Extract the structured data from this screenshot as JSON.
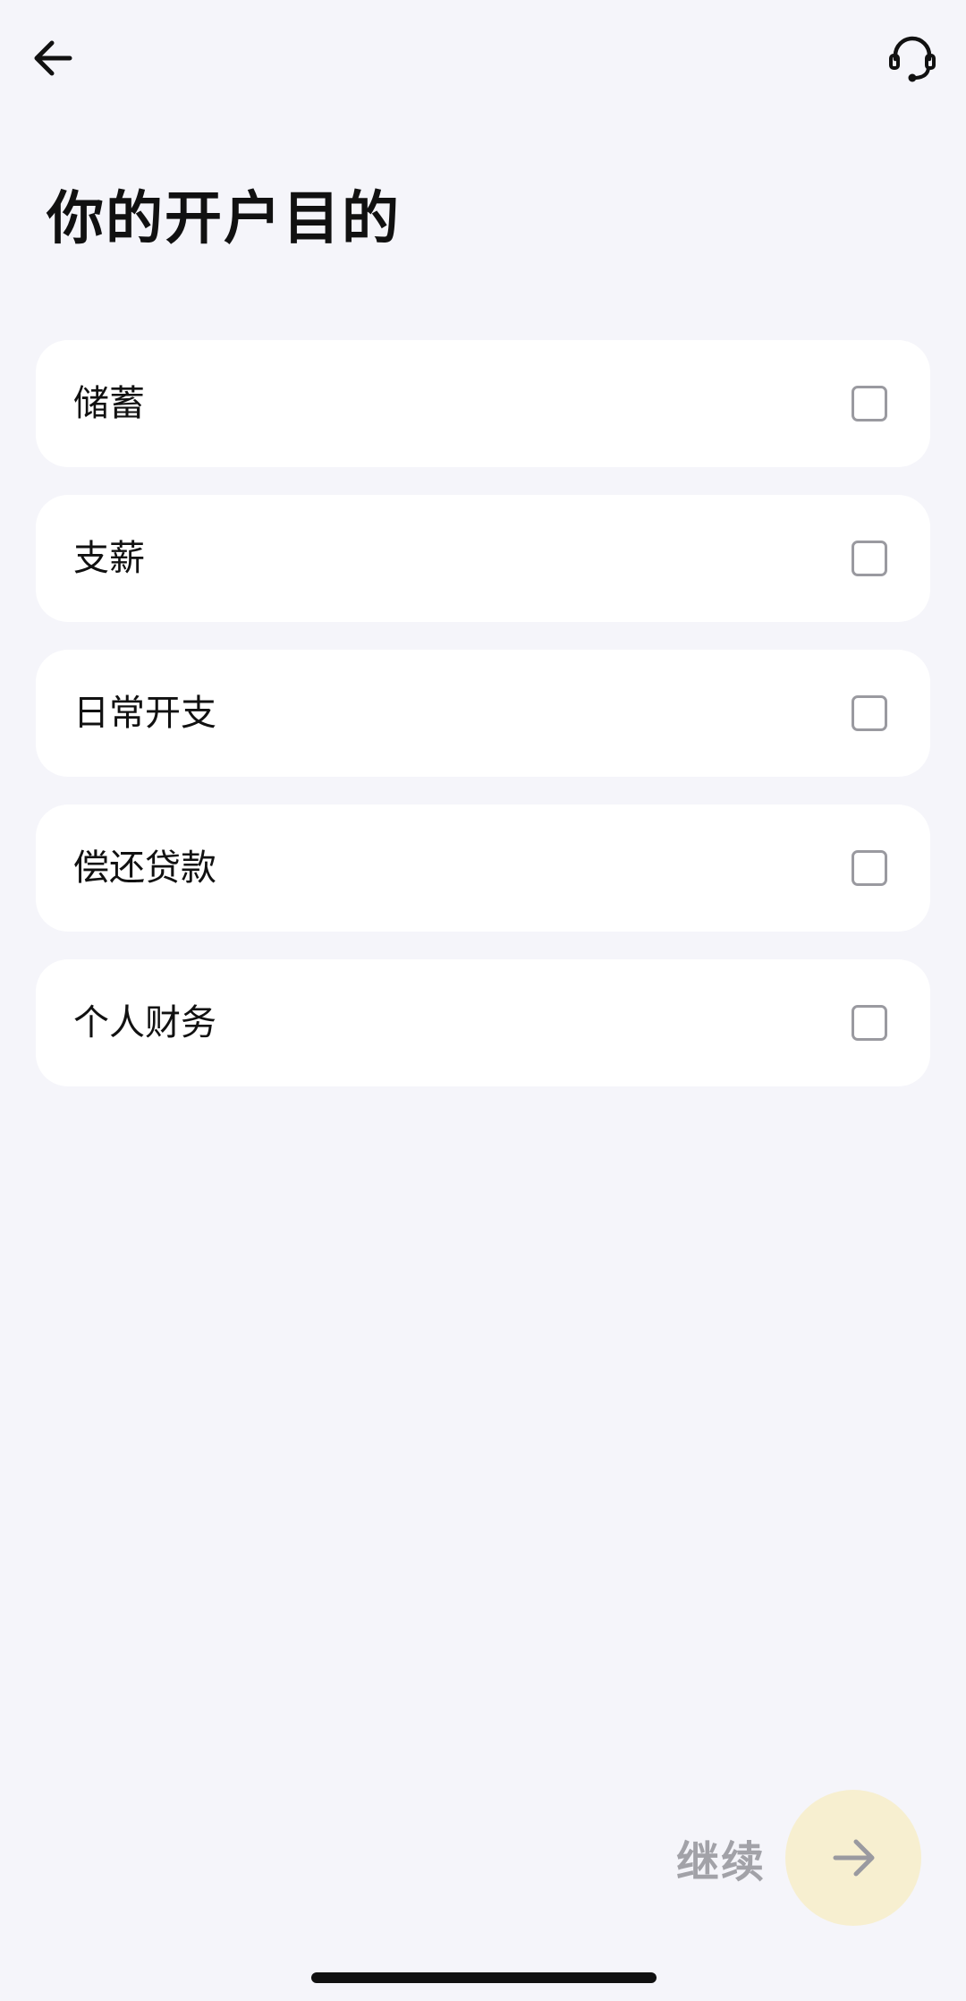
{
  "header": {
    "back_icon": "arrow-left-icon",
    "support_icon": "headset-icon"
  },
  "page": {
    "title": "你的开户目的"
  },
  "options": [
    {
      "label": "储蓄",
      "checked": false
    },
    {
      "label": "支薪",
      "checked": false
    },
    {
      "label": "日常开支",
      "checked": false
    },
    {
      "label": "偿还贷款",
      "checked": false
    },
    {
      "label": "个人财务",
      "checked": false
    }
  ],
  "footer": {
    "continue_label": "继续",
    "continue_icon": "arrow-right-icon"
  },
  "colors": {
    "background": "#f5f5fa",
    "card": "#ffffff",
    "checkbox_border": "#9a9aa0",
    "continue_text": "#a2a2a8",
    "continue_button": "#f7efd0"
  }
}
